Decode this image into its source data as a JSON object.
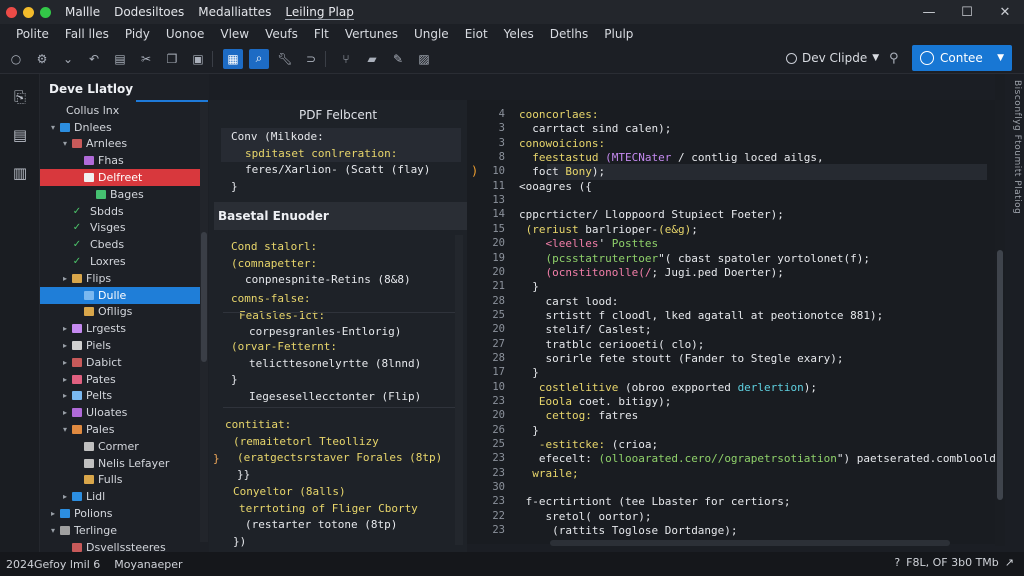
{
  "titlebar": {
    "menu": [
      "Mallle",
      "Dodesiltoes",
      "Medalliattes",
      "Leiling Plap"
    ],
    "active_index": 3,
    "window_controls": [
      "minimize-icon",
      "maximize-icon",
      "close-icon"
    ]
  },
  "menubar": [
    "Polite",
    "Fall lles",
    "Pidy",
    "Uonoe",
    "Vlew",
    "Veufs",
    "Flt",
    "Vertunes",
    "Ungle",
    "Eiot",
    "Yeles",
    "Detlhs",
    "Plulp"
  ],
  "toolbar": {
    "project_label": "Dev Clipde",
    "run_label": "Contee"
  },
  "explorer": {
    "title": "Deve Llatloy",
    "items": [
      {
        "label": "Collus lnx",
        "depth": 0,
        "arrow": "",
        "color": ""
      },
      {
        "label": "Dnlees",
        "depth": 0,
        "arrow": "▾",
        "color": "#2c8ee0"
      },
      {
        "label": "Arnlees",
        "depth": 1,
        "arrow": "▾",
        "color": "#c85a5a"
      },
      {
        "label": "Fhas",
        "depth": 2,
        "arrow": "",
        "color": "#b06ad8"
      },
      {
        "label": "Delfreet",
        "depth": 2,
        "arrow": "",
        "color": "#f0f0f0",
        "selected": "red"
      },
      {
        "label": "Bages",
        "depth": 3,
        "arrow": "",
        "color": "#45c070"
      },
      {
        "label": "Sbdds",
        "depth": 2,
        "arrow": "✓",
        "color": ""
      },
      {
        "label": "Visges",
        "depth": 2,
        "arrow": "✓",
        "color": ""
      },
      {
        "label": "Cbeds",
        "depth": 2,
        "arrow": "✓",
        "color": ""
      },
      {
        "label": "Loxres",
        "depth": 2,
        "arrow": "✓",
        "color": ""
      },
      {
        "label": "Flips",
        "depth": 1,
        "arrow": "▸",
        "color": "#d9a64a"
      },
      {
        "label": "Dulle",
        "depth": 2,
        "arrow": "",
        "color": "#7ab8f0",
        "selected": "blue"
      },
      {
        "label": "Oflligs",
        "depth": 2,
        "arrow": "",
        "color": "#d9a64a"
      },
      {
        "label": "Lrgests",
        "depth": 1,
        "arrow": "▸",
        "color": "#c58af0"
      },
      {
        "label": "Piels",
        "depth": 1,
        "arrow": "▸",
        "color": "#d0d0d0"
      },
      {
        "label": "Dabict",
        "depth": 1,
        "arrow": "▸",
        "color": "#c85a5a"
      },
      {
        "label": "Pates",
        "depth": 1,
        "arrow": "▸",
        "color": "#e06080"
      },
      {
        "label": "Pelts",
        "depth": 1,
        "arrow": "▸",
        "color": "#7ab8f0"
      },
      {
        "label": "Uloates",
        "depth": 1,
        "arrow": "▸",
        "color": "#b06ad8"
      },
      {
        "label": "Pales",
        "depth": 1,
        "arrow": "▾",
        "color": "#e08a40"
      },
      {
        "label": "Cormer",
        "depth": 2,
        "arrow": "",
        "color": "#c0c0c0"
      },
      {
        "label": "Nelis Lefayer",
        "depth": 2,
        "arrow": "",
        "color": "#c0c0c0"
      },
      {
        "label": "Fulls",
        "depth": 2,
        "arrow": "",
        "color": "#d9a64a"
      },
      {
        "label": "Lidl",
        "depth": 1,
        "arrow": "▸",
        "color": "#2c8ee0"
      },
      {
        "label": "Polions",
        "depth": 0,
        "arrow": "▸",
        "color": "#2c8ee0"
      },
      {
        "label": "Terlinge",
        "depth": 0,
        "arrow": "▾",
        "color": "#a0a0a0"
      },
      {
        "label": "Dsvellssteeres",
        "depth": 1,
        "arrow": "",
        "color": "#c85a5a"
      }
    ]
  },
  "middle": {
    "title": "PDF Felbcent",
    "block1": [
      "Conv (Milkode:",
      "spditaset conlreration:",
      "feres/Xarlion- (Scatt (flay)",
      "}"
    ],
    "header": "Basetal Enuoder",
    "block2": [
      "Cond stalorl:",
      "(comnapetter:",
      "conpnespnite-Retins (8&8)"
    ],
    "block3": [
      "comns-false:",
      "Fealsles-1ct:",
      "corpesgranles-Entlorig)"
    ],
    "block4": [
      "(orvar-Fetternt:",
      "telicttesonelyrtte (8lnnd)",
      "}",
      "Iegesesellecctonter (Flip)"
    ],
    "block5": [
      "contitiat:",
      "(remaitetorl Tteollizy",
      "(eratgectsrstaver Forales (8tp)",
      "}}"
    ],
    "block6": [
      "Conyeltor (8alls)",
      "terrtoting of Fliger Cborty",
      "(restarter totone (8tp)",
      "})"
    ]
  },
  "code": {
    "line_numbers": [
      4,
      3,
      3,
      8,
      10,
      11,
      13,
      14,
      15,
      20,
      19,
      20,
      21,
      28,
      25,
      20,
      27,
      28,
      17,
      10,
      23,
      20,
      26,
      25,
      23,
      23,
      30,
      23,
      22,
      23
    ],
    "lines": [
      [
        [
          "c-yel",
          "cooncorlaes:"
        ]
      ],
      [
        [
          "c-wht",
          "  carrtact sind calen);"
        ]
      ],
      [
        [
          "c-yel",
          "conowoicions:"
        ]
      ],
      [
        [
          "c-yel",
          "  feestastud "
        ],
        [
          "c-pur",
          "(MTECNater"
        ],
        [
          "c-wht",
          " / contlig loced ailgs,"
        ]
      ],
      [
        [
          "c-wht",
          "  foct "
        ],
        [
          "c-yel",
          "Bony"
        ],
        [
          "c-wht",
          ");"
        ]
      ],
      [
        [
          "c-wht",
          "<ooagres ("
        ],
        [
          "c-wht",
          "{"
        ]
      ],
      [
        [
          "c-wht",
          ""
        ]
      ],
      [
        [
          "c-wht",
          "cppcrticter/ "
        ],
        [
          "c-wht",
          "Lloppoord Stupiect Foeter);"
        ]
      ],
      [
        [
          "c-yel",
          " (reriust "
        ],
        [
          "c-wht",
          "barlrioper-"
        ],
        [
          "c-yel",
          "(e&g)"
        ],
        [
          "c-wht",
          ";"
        ]
      ],
      [
        [
          "c-pnk",
          "    <leelles"
        ],
        [
          "c-wht",
          "' "
        ],
        [
          "c-grn",
          "Posttes"
        ]
      ],
      [
        [
          "c-grn",
          "    (pcsstatrutertoer"
        ],
        [
          "c-wht",
          "\"( cbast spatoler yortolonet(f);"
        ]
      ],
      [
        [
          "c-pnk",
          "    (ocnstitonolle(/"
        ],
        [
          "c-wht",
          "; Jugi.ped Doerter);"
        ]
      ],
      [
        [
          "c-wht",
          "  }"
        ]
      ],
      [
        [
          "c-wht",
          "    carst lood:"
        ]
      ],
      [
        [
          "c-wht",
          "    srtistt f cloodl, lked agatall at peotionotce 881);"
        ]
      ],
      [
        [
          "c-wht",
          "    stelif/ Caslest;"
        ]
      ],
      [
        [
          "c-wht",
          "    tratblc ceriooeti( clo);"
        ]
      ],
      [
        [
          "c-wht",
          "    sorirle fete stoutt "
        ],
        [
          "c-wht",
          "(Fander to Stegle exary);"
        ]
      ],
      [
        [
          "c-wht",
          "  }"
        ]
      ],
      [
        [
          "c-yel",
          "   costlelitive "
        ],
        [
          "c-wht",
          "(obroo expported "
        ],
        [
          "c-cyn",
          "derlertion"
        ],
        [
          "c-wht",
          ");"
        ]
      ],
      [
        [
          "c-yel",
          "   Eoola "
        ],
        [
          "c-wht",
          "coet. bitigy);"
        ]
      ],
      [
        [
          "c-yel",
          "    cettog: "
        ],
        [
          "c-wht",
          "fatres"
        ]
      ],
      [
        [
          "c-wht",
          "  }"
        ]
      ],
      [
        [
          "c-yel",
          "   -estitcke: "
        ],
        [
          "c-wht",
          "(crioa;"
        ]
      ],
      [
        [
          "c-wht",
          "   efecelt: "
        ],
        [
          "c-grn",
          "(ollooarated.cero//ograpetrsotiation"
        ],
        [
          "c-wht",
          "\") "
        ],
        [
          "c-wht",
          "paetserated.combloold("
        ]
      ],
      [
        [
          "c-yel",
          "  wraile;"
        ]
      ],
      [
        [
          "c-wht",
          ""
        ]
      ],
      [
        [
          "c-wht",
          " f-ecrtirtiont "
        ],
        [
          "c-wht",
          "(tee Lbaster for certiors;"
        ]
      ],
      [
        [
          "c-wht",
          "    sretol( "
        ],
        [
          "c-wht",
          "oortor);"
        ]
      ],
      [
        [
          "c-wht",
          "     (rattits "
        ],
        [
          "c-wht",
          "Toglose Dortdange);"
        ]
      ]
    ]
  },
  "sidebar_vertical_text": "Bisconflyg Ftoumitt Platiog",
  "status": {
    "left": "2024Gefoy lmil 6",
    "left2": "Moyanaeper",
    "right": [
      "?",
      "F8L, OF 3b0 TMb",
      "↗"
    ]
  }
}
